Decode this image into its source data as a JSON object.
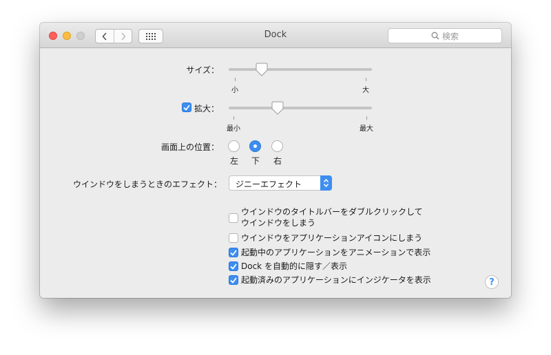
{
  "window": {
    "title": "Dock",
    "search_placeholder": "検索"
  },
  "size": {
    "label": "サイズ：",
    "value": 0.23,
    "min_label": "小",
    "max_label": "大"
  },
  "magnification": {
    "label": "拡大：",
    "enabled": true,
    "value": 0.34,
    "min_label": "最小",
    "max_label": "最大"
  },
  "position": {
    "label": "画面上の位置：",
    "options": [
      "左",
      "下",
      "右"
    ],
    "selected": "下"
  },
  "minimize_effect": {
    "label": "ウインドウをしまうときのエフェクト：",
    "value": "ジニーエフェクト"
  },
  "options": [
    {
      "label_line1": "ウインドウのタイトルバーをダブルクリックして",
      "label_line2": "ウインドウをしまう",
      "checked": false
    },
    {
      "label_line1": "ウインドウをアプリケーションアイコンにしまう",
      "checked": false
    },
    {
      "label_line1": "起動中のアプリケーションをアニメーションで表示",
      "checked": true
    },
    {
      "label_line1": "Dock を自動的に隠す／表示",
      "checked": true
    },
    {
      "label_line1": "起動済みのアプリケーションにインジケータを表示",
      "checked": true
    }
  ],
  "help_label": "?",
  "colors": {
    "accent": "#3d8ef0",
    "close": "#fc605c",
    "minimize": "#fdbc40",
    "zoom_disabled": "#cfcfcf"
  }
}
